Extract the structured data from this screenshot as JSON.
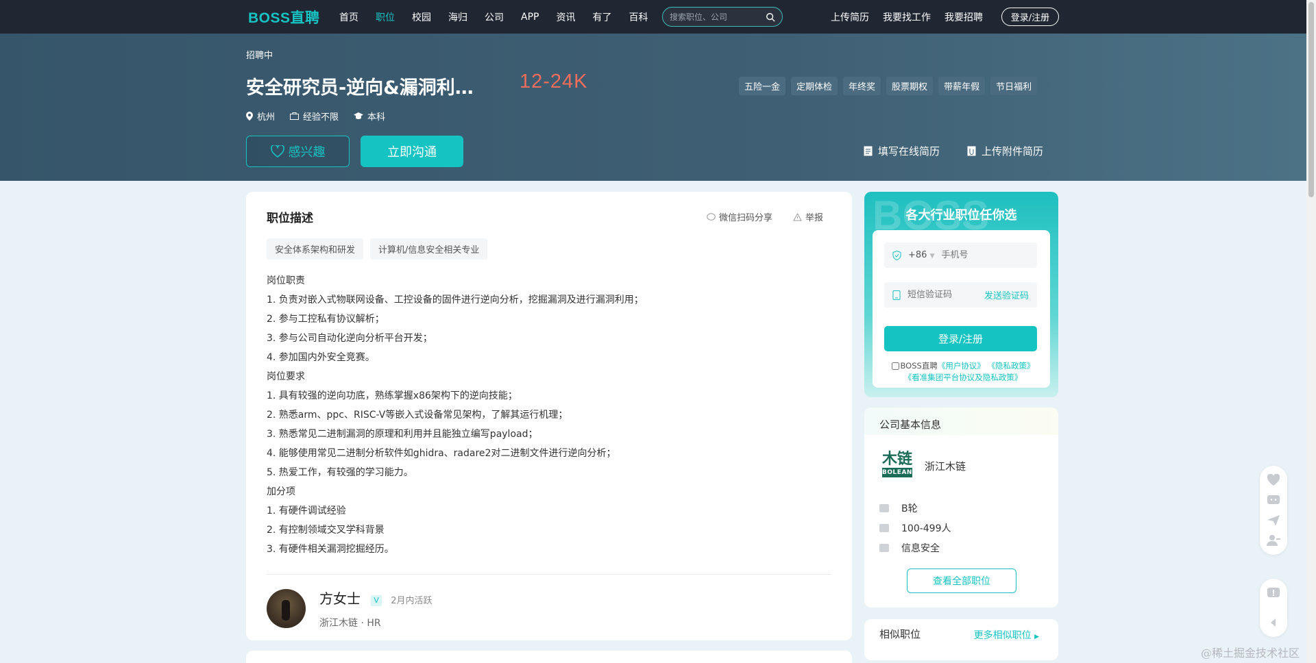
{
  "header": {
    "logo": "BOSS直聘",
    "nav": [
      "首页",
      "职位",
      "校园",
      "海归",
      "公司",
      "APP",
      "资讯",
      "有了",
      "百科"
    ],
    "active_nav": "职位",
    "search_placeholder": "搜索职位、公司",
    "right_links": [
      "上传简历",
      "我要找工作",
      "我要招聘"
    ],
    "login_label": "登录/注册"
  },
  "job": {
    "status": "招聘中",
    "title": "安全研究员-逆向&漏洞利…",
    "salary": "12-24K",
    "benefits": [
      "五险一金",
      "定期体检",
      "年终奖",
      "股票期权",
      "带薪年假",
      "节日福利"
    ],
    "city": "杭州",
    "experience": "经验不限",
    "degree": "本科",
    "interest_label": "感兴趣",
    "chat_label": "立即沟通",
    "online_resume_label": "填写在线简历",
    "upload_resume_label": "上传附件简历"
  },
  "description": {
    "heading": "职位描述",
    "share_label": "微信扫码分享",
    "report_label": "举报",
    "tags": [
      "安全体系架构和研发",
      "计算机/信息安全相关专业"
    ],
    "lines": [
      "岗位职责",
      "1. 负责对嵌入式物联网设备、工控设备的固件进行逆向分析，挖掘漏洞及进行漏洞利用；",
      "2. 参与工控私有协议解析；",
      "3. 参与公司自动化逆向分析平台开发；",
      "4. 参加国内外安全竞赛。",
      "岗位要求",
      "1. 具有较强的逆向功底，熟练掌握x86架构下的逆向技能；",
      "2. 熟悉arm、ppc、RISC-V等嵌入式设备常见架构，了解其运行机理；",
      "3. 熟悉常见二进制漏洞的原理和利用并且能独立编写payload；",
      "4. 能够使用常见二进制分析软件如ghidra、radare2对二进制文件进行逆向分析；",
      "5. 热爱工作，有较强的学习能力。",
      "加分项",
      "1. 有硬件调试经验",
      "2. 有控制领域交叉学科背景",
      "3. 有硬件相关漏洞挖掘经历。"
    ]
  },
  "recruiter": {
    "name": "方女士",
    "verified_badge": "V",
    "active": "2月内活跃",
    "company": "浙江木链",
    "role": "HR"
  },
  "login_card": {
    "bg_text": "BOSS",
    "title": "各大行业职位任你选",
    "country_code": "+86",
    "phone_placeholder": "手机号",
    "code_placeholder": "短信验证码",
    "send_code": "发送验证码",
    "submit": "登录/注册",
    "agree_prefix": "BOSS直聘",
    "user_agreement": "《用户协议》",
    "privacy": "《隐私政策》",
    "group_policy": "《看准集团平台协议及隐私政策》"
  },
  "company": {
    "heading": "公司基本信息",
    "logo_text": "木链",
    "logo_sub": "BOLEAN",
    "name": "浙江木链",
    "stage": "B轮",
    "size": "100-499人",
    "industry": "信息安全",
    "all_jobs": "查看全部职位"
  },
  "similar": {
    "heading": "相似职位",
    "more": "更多相似职位"
  },
  "watermark": "@稀土掘金技术社区",
  "colors": {
    "brand": "#16c3c3",
    "salary": "#f26d5b",
    "topbar": "#202733"
  }
}
